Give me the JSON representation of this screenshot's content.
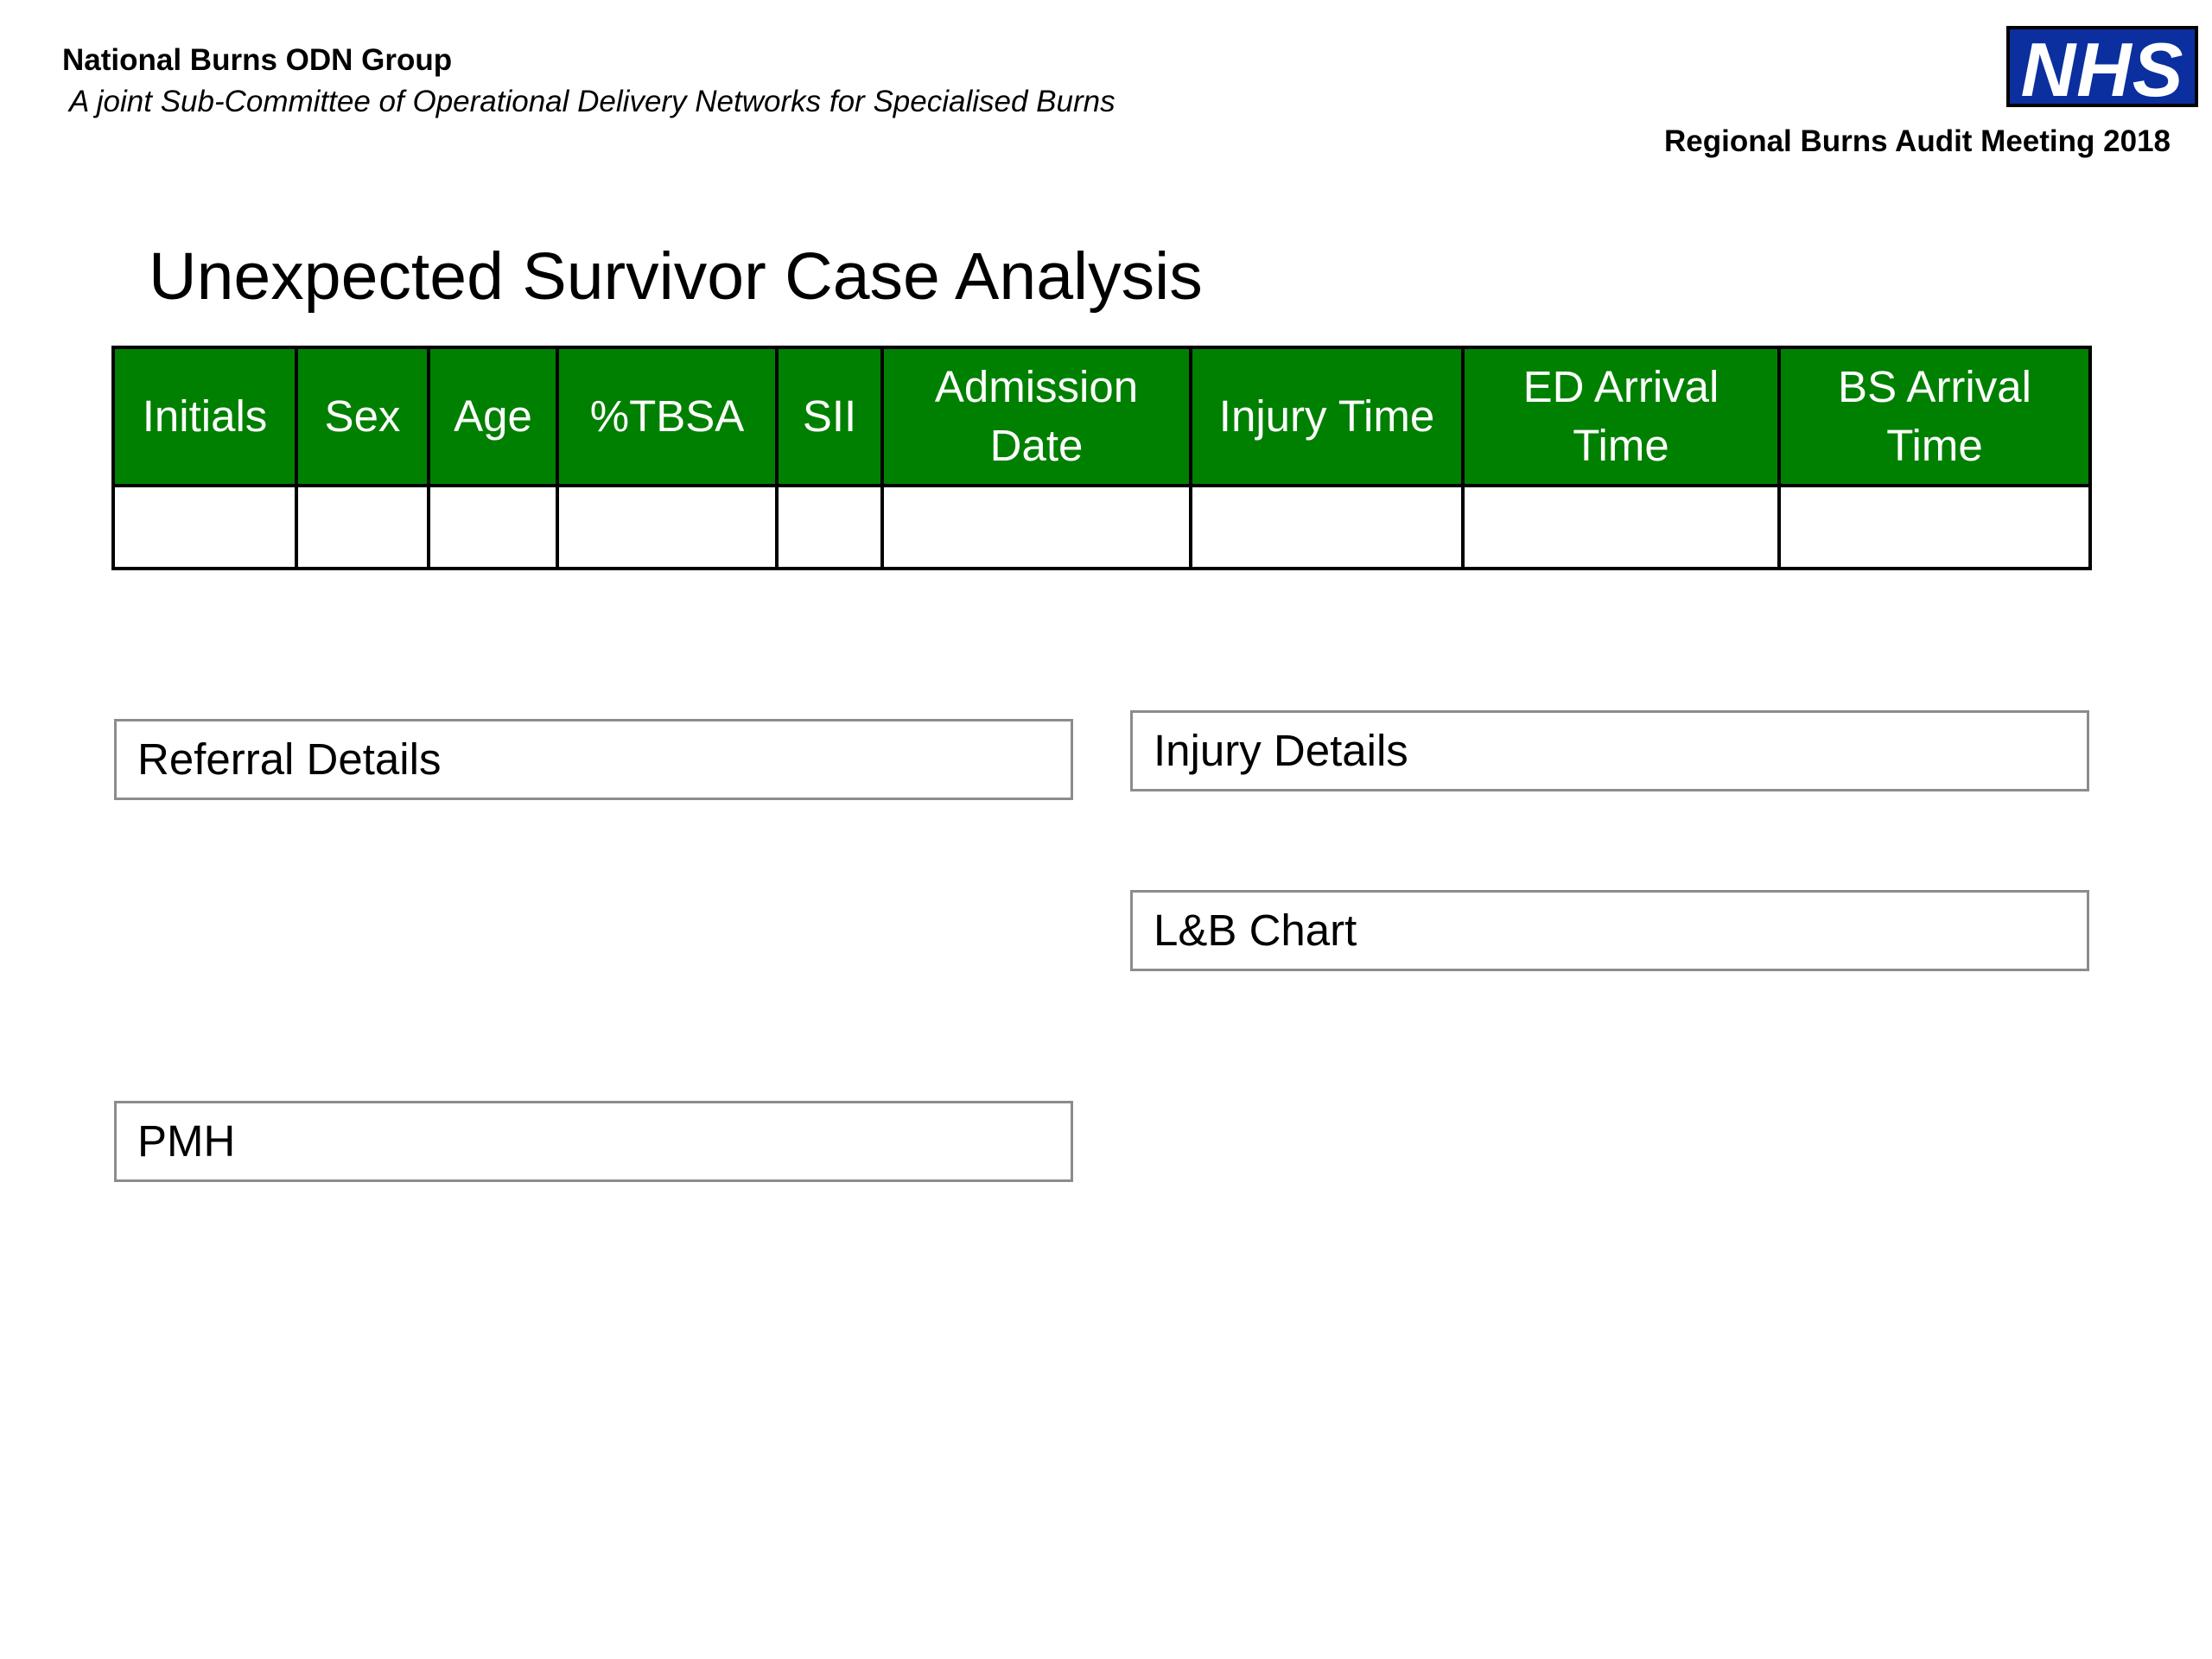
{
  "header": {
    "org_name": "National Burns ODN Group",
    "org_subtitle": "A joint Sub-Committee of Operational Delivery Networks for Specialised Burns",
    "logo_text": "NHS",
    "meeting": "Regional Burns Audit Meeting 2018"
  },
  "title": "Unexpected Survivor Case Analysis",
  "table": {
    "columns": [
      "Initials",
      "Sex",
      "Age",
      "%TBSA",
      "SII",
      "Admission Date",
      "Injury Time",
      "ED Arrival Time",
      "BS Arrival Time"
    ],
    "rows": [
      [
        "",
        "",
        "",
        "",
        "",
        "",
        "",
        "",
        ""
      ]
    ]
  },
  "sections": {
    "referral": "Referral Details",
    "injury": "Injury Details",
    "lb_chart": "L&B Chart",
    "pmh": "PMH"
  },
  "colors": {
    "header_green": "#008000",
    "nhs_blue": "#0b2f9e"
  }
}
